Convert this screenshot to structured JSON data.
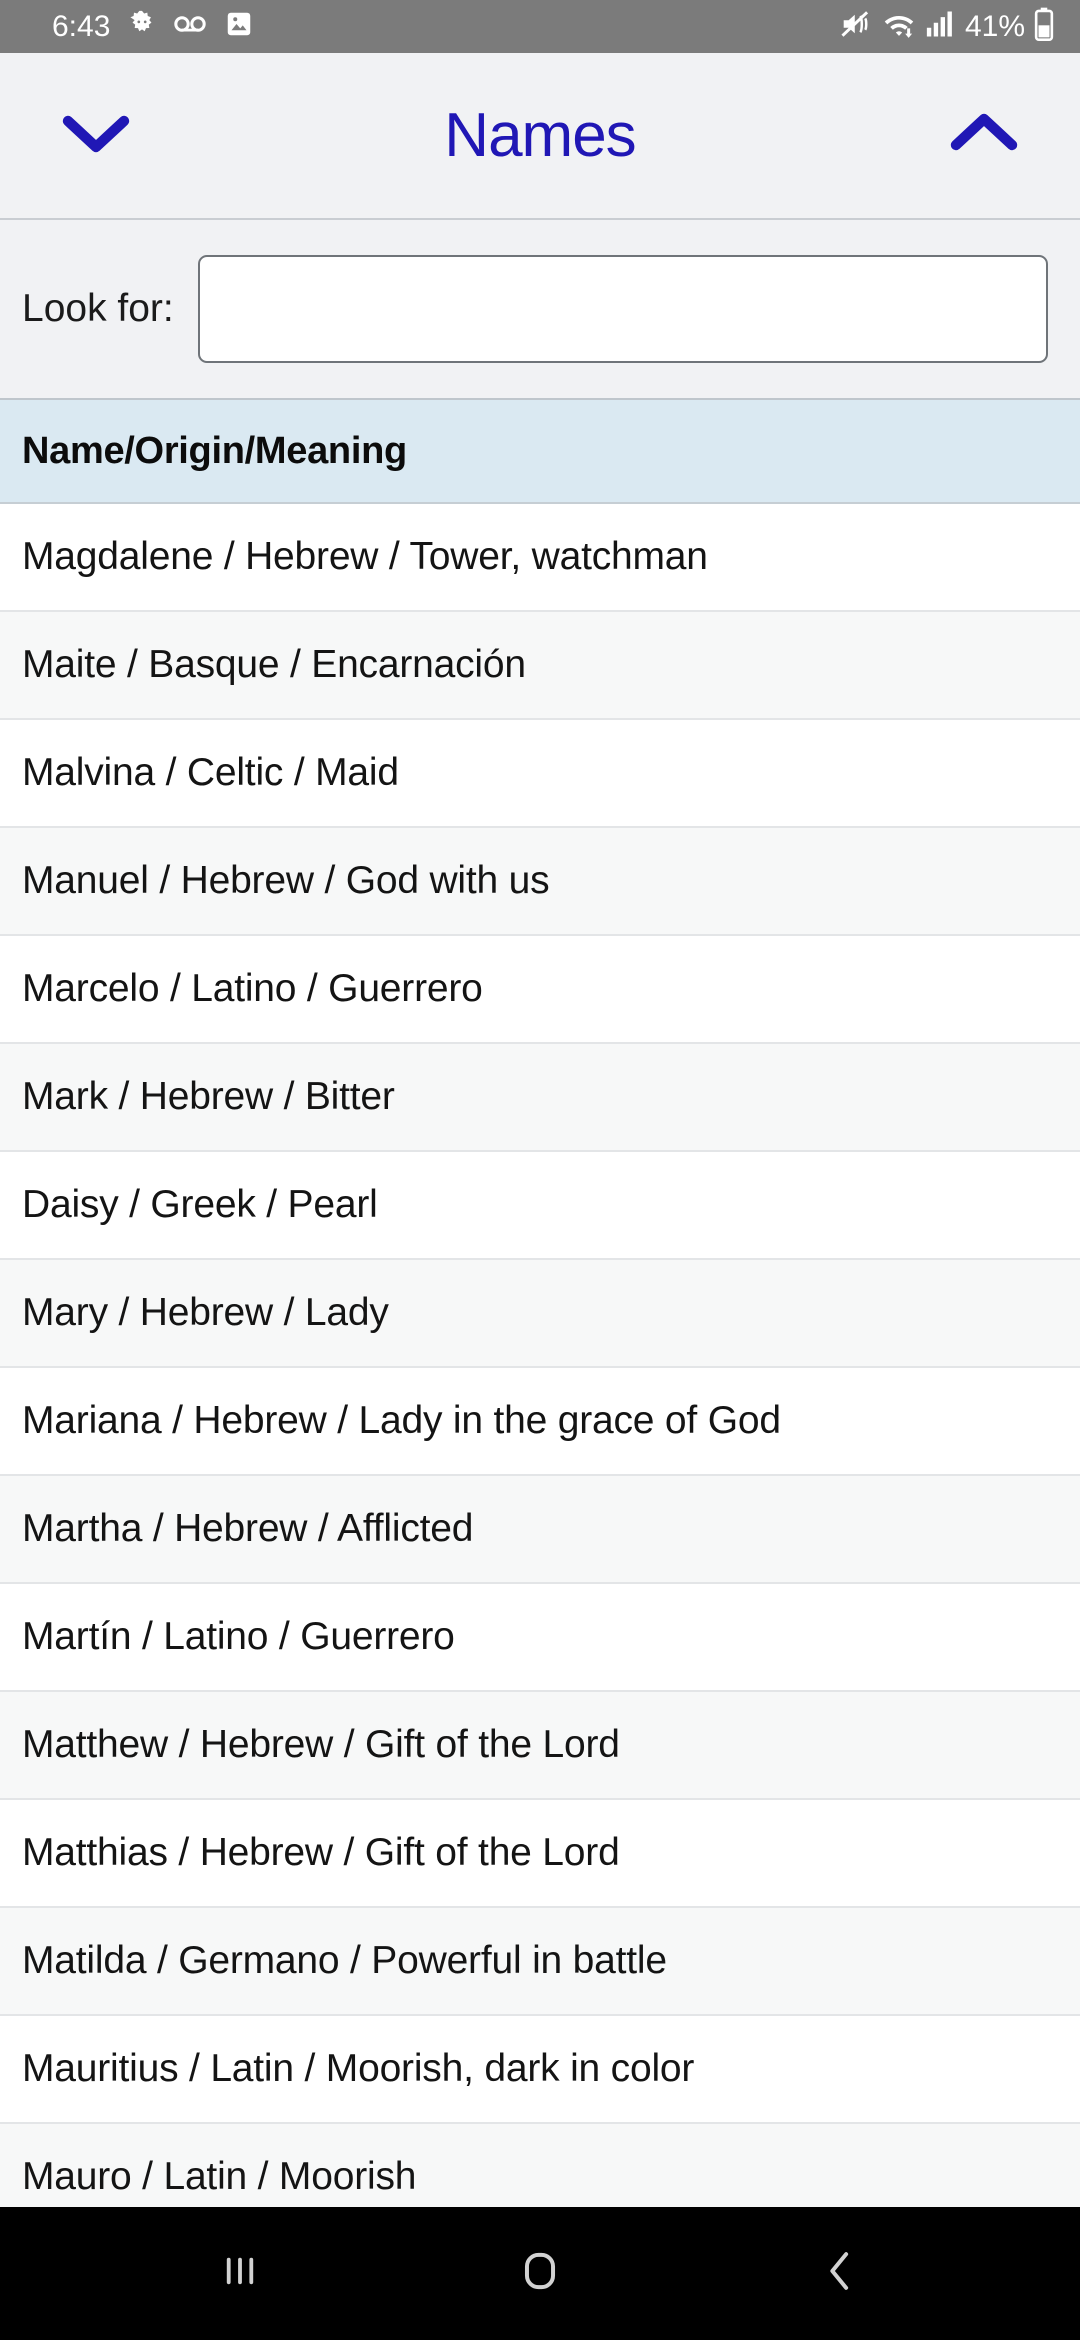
{
  "status_bar": {
    "time": "6:43",
    "battery_percent": "41%",
    "left_icons": [
      "android-gear-icon",
      "voicemail-icon",
      "image-icon"
    ],
    "right_icons": [
      "mute-vibrate-icon",
      "wifi-icon",
      "cellular-signal-icon",
      "battery-icon"
    ],
    "background": "#7b7b7b"
  },
  "header": {
    "title": "Names",
    "title_color": "#2017b5",
    "left_icon": "chevron-down-icon",
    "right_icon": "chevron-up-icon"
  },
  "search": {
    "label": "Look for:",
    "value": "",
    "placeholder": ""
  },
  "table": {
    "header_label": "Name/Origin/Meaning",
    "header_background": "#dae9f2",
    "rows": [
      "Magdalene / Hebrew / Tower, watchman",
      "Maite / Basque / Encarnación",
      "Malvina / Celtic / Maid",
      "Manuel / Hebrew / God with us",
      "Marcelo / Latino / Guerrero",
      "Mark / Hebrew / Bitter",
      "Daisy / Greek / Pearl",
      "Mary / Hebrew / Lady",
      "Mariana / Hebrew / Lady in the grace of God",
      "Martha / Hebrew / Afflicted",
      "Martín / Latino / Guerrero",
      "Matthew / Hebrew / Gift of the Lord",
      "Matthias / Hebrew / Gift of the Lord",
      "Matilda / Germano / Powerful in battle",
      "Mauritius / Latin / Moorish, dark in color",
      "Mauro / Latin / Moorish"
    ]
  },
  "nav_bar": {
    "items": [
      "recents-icon",
      "home-icon",
      "back-icon"
    ],
    "background": "#000000"
  }
}
